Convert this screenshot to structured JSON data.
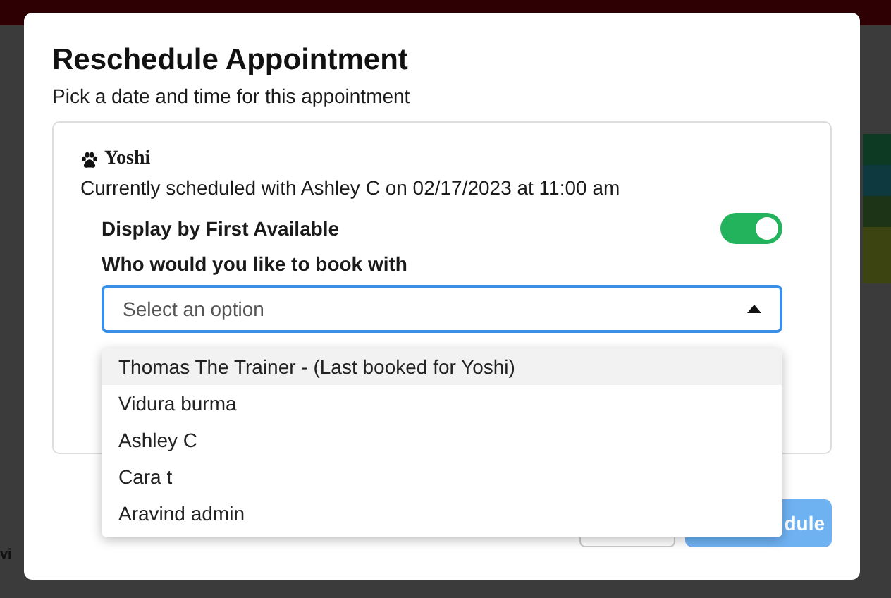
{
  "background": {
    "edge_texts": [
      "vi"
    ]
  },
  "dialog": {
    "title": "Reschedule Appointment",
    "subtitle": "Pick a date and time for this appointment",
    "pet_name": "Yoshi",
    "current": "Currently scheduled with Ashley C on 02/17/2023 at 11:00 am",
    "first_available": {
      "label": "Display by First Available",
      "on": true
    },
    "staff_label": "Who would you like to book with",
    "staff_select": {
      "placeholder": "Select an option",
      "expanded": true,
      "options": [
        {
          "label": "Thomas The Trainer - (Last booked for Yoshi)",
          "selected": true
        },
        {
          "label": "Vidura burma",
          "selected": false
        },
        {
          "label": "Ashley C",
          "selected": false
        },
        {
          "label": "Cara t",
          "selected": false
        },
        {
          "label": "Aravind admin",
          "selected": false
        }
      ]
    },
    "schedule_button": {
      "label": "dule",
      "disabled": true
    }
  }
}
